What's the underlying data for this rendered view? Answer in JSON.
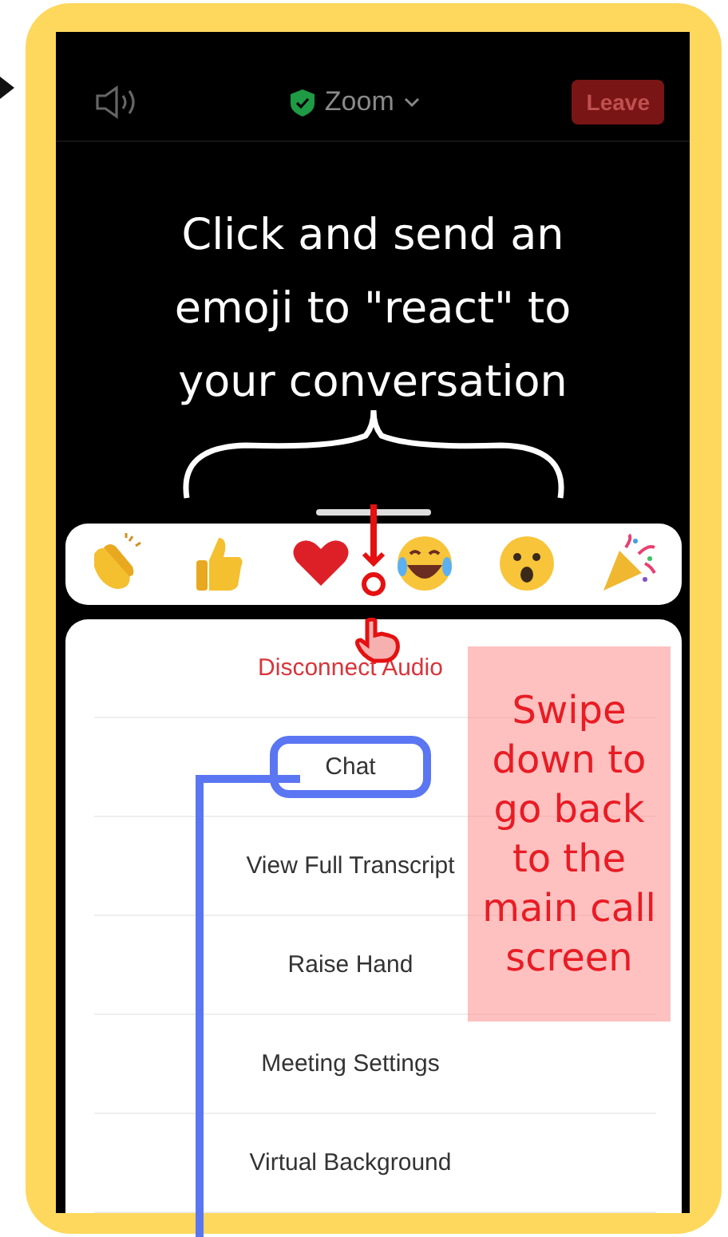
{
  "top_bar": {
    "title": "Zoom",
    "leave_button": "Leave"
  },
  "annotation_heading": "Click and send an emoji to \"react\" to your conversation",
  "reactions": [
    {
      "kind": "clap"
    },
    {
      "kind": "thumbs"
    },
    {
      "kind": "heart"
    },
    {
      "kind": "laugh"
    },
    {
      "kind": "surprised"
    },
    {
      "kind": "party"
    }
  ],
  "menu": [
    {
      "label": "Disconnect Audio",
      "kind": "danger",
      "highlighted": false
    },
    {
      "label": "Chat",
      "kind": "normal",
      "highlighted": true
    },
    {
      "label": "View Full Transcript",
      "kind": "normal",
      "highlighted": false
    },
    {
      "label": "Raise Hand",
      "kind": "normal",
      "highlighted": false
    },
    {
      "label": "Meeting Settings",
      "kind": "normal",
      "highlighted": false
    },
    {
      "label": "Virtual Background",
      "kind": "normal",
      "highlighted": false
    }
  ],
  "swipe_note": "Swipe down to go back to the main call screen"
}
